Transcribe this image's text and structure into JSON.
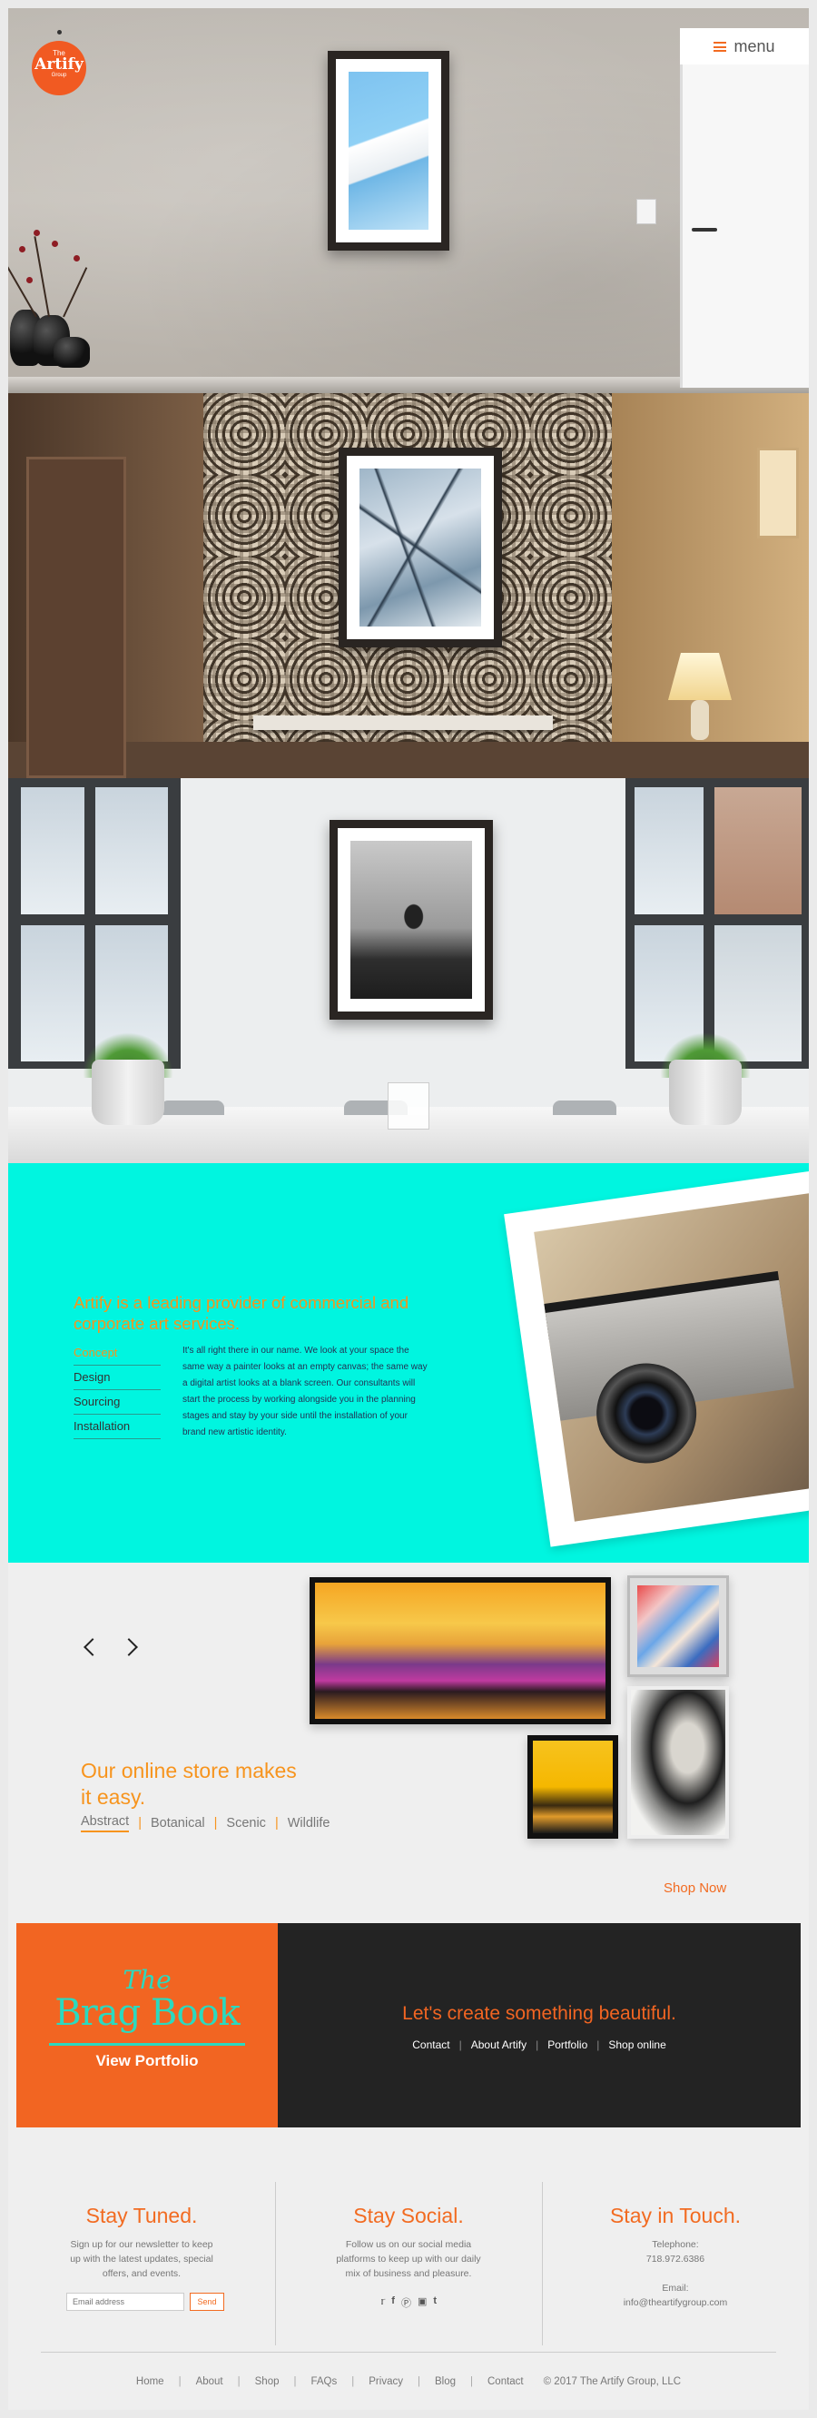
{
  "header": {
    "logo": {
      "line1": "The",
      "name": "Artify",
      "line3": "Group"
    },
    "menu_label": "menu"
  },
  "about": {
    "heading": "Artify is a leading provider of commercial and corporate art services.",
    "nav": [
      "Concept",
      "Design",
      "Sourcing",
      "Installation"
    ],
    "active_index": 0,
    "body": "It's all right there in our name. We look at your space the same way a painter looks at an empty canvas; the same way a digital artist looks at a blank screen. Our consultants will start the process by working alongside you in the planning stages and stay by your side until the installation of your brand new artistic identity."
  },
  "store": {
    "heading": "Our online store makes it easy.",
    "categories": [
      "Abstract",
      "Botanical",
      "Scenic",
      "Wildlife"
    ],
    "active_category": "Abstract",
    "shop_now": "Shop Now"
  },
  "brag": {
    "title_small": "The",
    "title_large": "Brag Book",
    "button": "View Portfolio",
    "cta": "Let's create something beautiful.",
    "links": [
      "Contact",
      "About Artify",
      "Portfolio",
      "Shop online"
    ]
  },
  "footer": {
    "tuned": {
      "title": "Stay Tuned.",
      "text": "Sign up for our newsletter to keep up with the latest updates, special offers, and events.",
      "email_placeholder": "Email address",
      "send_label": "Send"
    },
    "social": {
      "title": "Stay Social.",
      "text": "Follow us on our social media platforms to keep up with our daily mix of business and pleasure.",
      "icons": [
        "twitter-icon",
        "facebook-icon",
        "pinterest-icon",
        "instagram-icon",
        "tumblr-icon"
      ]
    },
    "touch": {
      "title": "Stay in Touch.",
      "tel_label": "Telephone:",
      "tel": "718.972.6386",
      "email_label": "Email:",
      "email": "info@theartifygroup.com"
    },
    "nav": [
      "Home",
      "About",
      "Shop",
      "FAQs",
      "Privacy",
      "Blog",
      "Contact"
    ],
    "copyright": "© 2017 The Artify Group, LLC"
  },
  "colors": {
    "accent": "#f26b21",
    "cyan": "#00f5e0",
    "teal": "#2bd9bf",
    "dark": "#232323"
  }
}
